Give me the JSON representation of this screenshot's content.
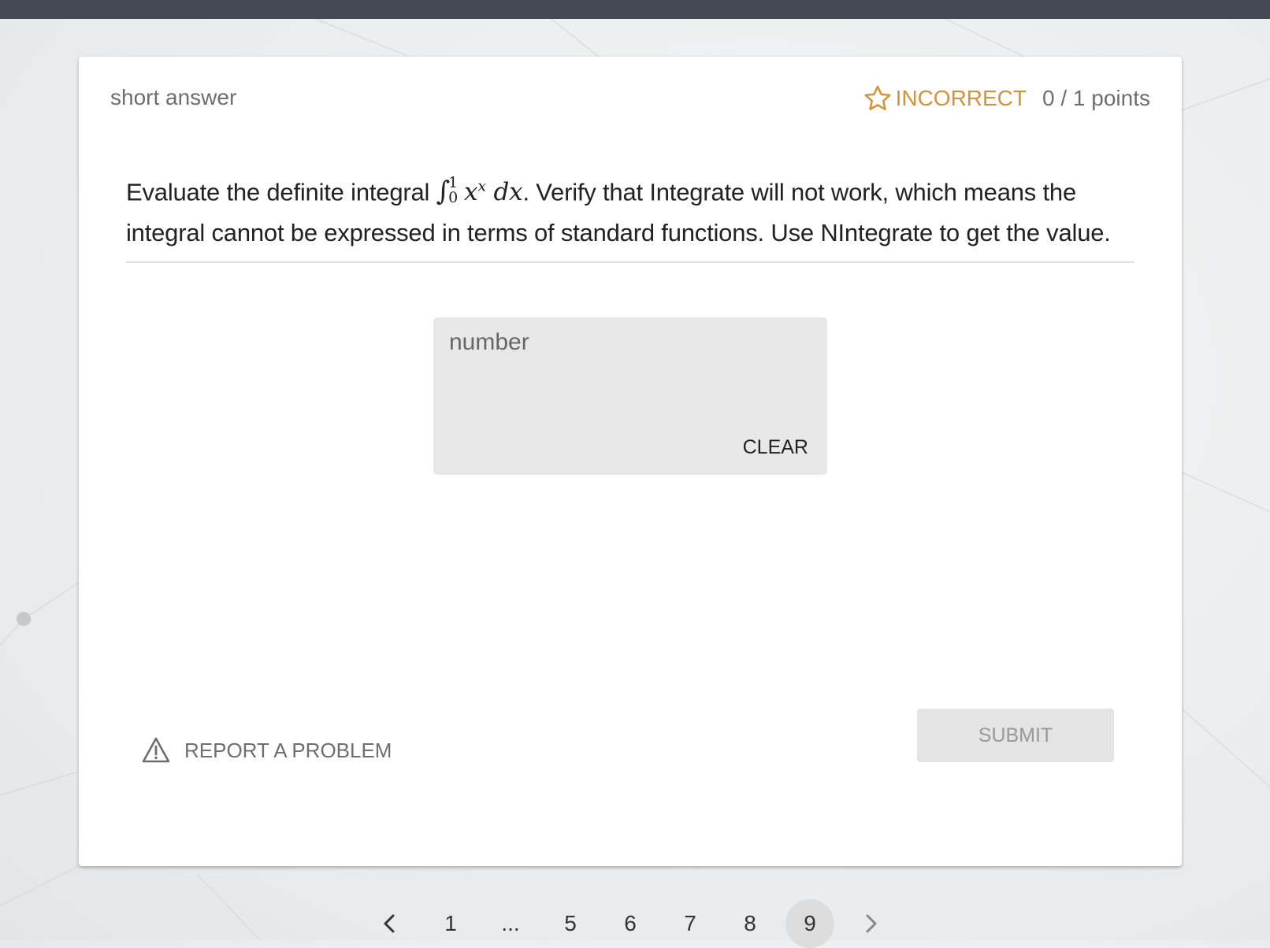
{
  "header": {
    "question_type": "short answer",
    "status": "INCORRECT",
    "points": "0 / 1 points"
  },
  "question": {
    "text_before": "Evaluate the definite integral",
    "math": {
      "integral_sign": "∫",
      "upper_limit": "1",
      "lower_limit": "0",
      "base": "x",
      "exponent": "x",
      "differential": "dx"
    },
    "text_after": ". Verify that Integrate will not work, which means the integral cannot be expressed in terms of standard functions. Use NIntegrate to get the value."
  },
  "answer": {
    "placeholder": "number",
    "value": "",
    "clear_label": "CLEAR"
  },
  "footer": {
    "report_label": "REPORT A PROBLEM",
    "submit_label": "SUBMIT"
  },
  "pagination": {
    "pages": [
      "1",
      "...",
      "5",
      "6",
      "7",
      "8",
      "9"
    ],
    "current": "9"
  },
  "colors": {
    "incorrect": "#d4923b",
    "topbar": "#444754"
  }
}
